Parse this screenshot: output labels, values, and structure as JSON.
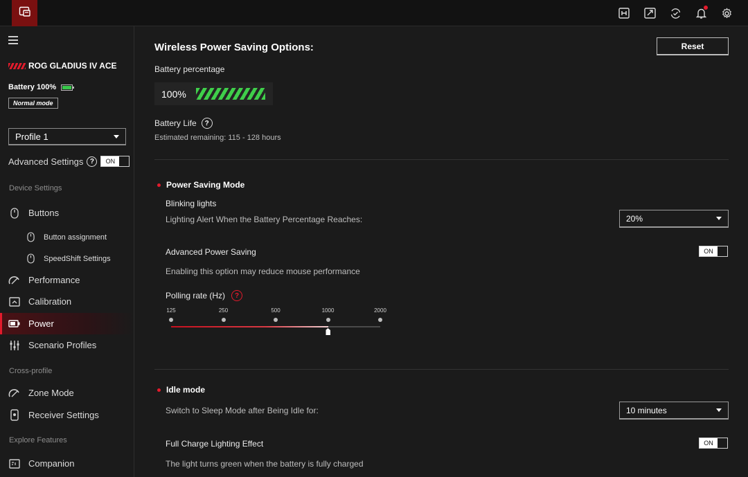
{
  "topbar": {
    "icons": [
      "macro-icon",
      "screen-record-icon",
      "update-icon",
      "bell-icon",
      "gear-icon"
    ]
  },
  "sidebar": {
    "device_name": "ROG GLADIUS IV ACE",
    "battery_label": "Battery 100%",
    "mode_badge": "Normal mode",
    "profile": "Profile 1",
    "advanced_settings_label": "Advanced Settings",
    "advanced_toggle": "ON",
    "sections": {
      "device": "Device Settings",
      "cross": "Cross-profile",
      "explore": "Explore Features"
    },
    "items": [
      {
        "label": "Buttons",
        "icon": "mouse-icon"
      },
      {
        "label": "Button assignment",
        "icon": "mouse-icon"
      },
      {
        "label": "SpeedShift Settings",
        "icon": "mouse-icon"
      },
      {
        "label": "Performance",
        "icon": "gauge-icon"
      },
      {
        "label": "Calibration",
        "icon": "calibration-icon"
      },
      {
        "label": "Power",
        "icon": "battery-icon"
      },
      {
        "label": "Scenario Profiles",
        "icon": "sliders-icon"
      },
      {
        "label": "Zone Mode",
        "icon": "gauge-icon"
      },
      {
        "label": "Receiver Settings",
        "icon": "receiver-icon"
      },
      {
        "label": "Companion",
        "icon": "companion-icon"
      }
    ],
    "active_item": "Power"
  },
  "main": {
    "title": "Wireless Power Saving Options:",
    "reset_label": "Reset",
    "battery_percentage_label": "Battery percentage",
    "battery_value": "100%",
    "battery_level": 1.0,
    "battery_life_label": "Battery Life",
    "battery_estimate": "Estimated remaining: 115 - 128 hours",
    "power_saving": {
      "heading": "Power Saving Mode",
      "blinking_label": "Blinking lights",
      "blinking_desc": "Lighting Alert When the Battery Percentage Reaches:",
      "blinking_value": "20%",
      "advanced_label": "Advanced Power Saving",
      "advanced_toggle": "ON",
      "advanced_desc": "Enabling this option may reduce mouse performance",
      "polling_label": "Polling rate (Hz)",
      "polling_options": [
        "125",
        "250",
        "500",
        "1000",
        "2000"
      ],
      "polling_selected": "1000"
    },
    "idle": {
      "heading": "Idle mode",
      "sleep_desc": "Switch to Sleep Mode after Being Idle for:",
      "sleep_value": "10 minutes",
      "full_charge_label": "Full Charge Lighting Effect",
      "full_charge_toggle": "ON",
      "full_charge_desc": "The light turns green when the battery is fully charged"
    }
  },
  "colors": {
    "accent": "#e21b2c",
    "battery_green": "#3fcf4a",
    "background": "#1b1b1b"
  }
}
